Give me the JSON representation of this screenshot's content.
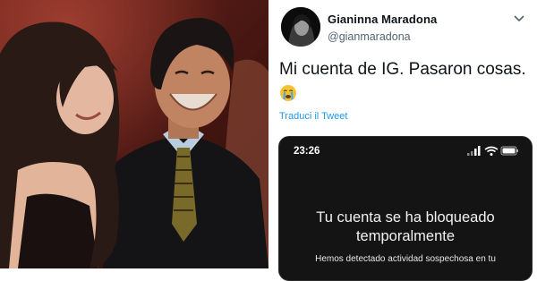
{
  "tweet": {
    "display_name": "Gianinna Maradona",
    "handle": "@gianmaradona",
    "text": "Mi cuenta de IG. Pasaron cosas.",
    "emoji": "crying-face-emoji",
    "translate_label": "Traduci il Tweet"
  },
  "phone": {
    "time": "23:26",
    "lock_title_line1": "Tu cuenta se ha bloqueado",
    "lock_title_line2": "temporalmente",
    "lock_body": "Hemos detectado actividad sospechosa en tu"
  },
  "colors": {
    "link_blue": "#1d9bf0",
    "text_dark": "#0f1419",
    "text_muted": "#536471",
    "phone_bg": "#141414",
    "photo_bg": "#5a1e18"
  }
}
